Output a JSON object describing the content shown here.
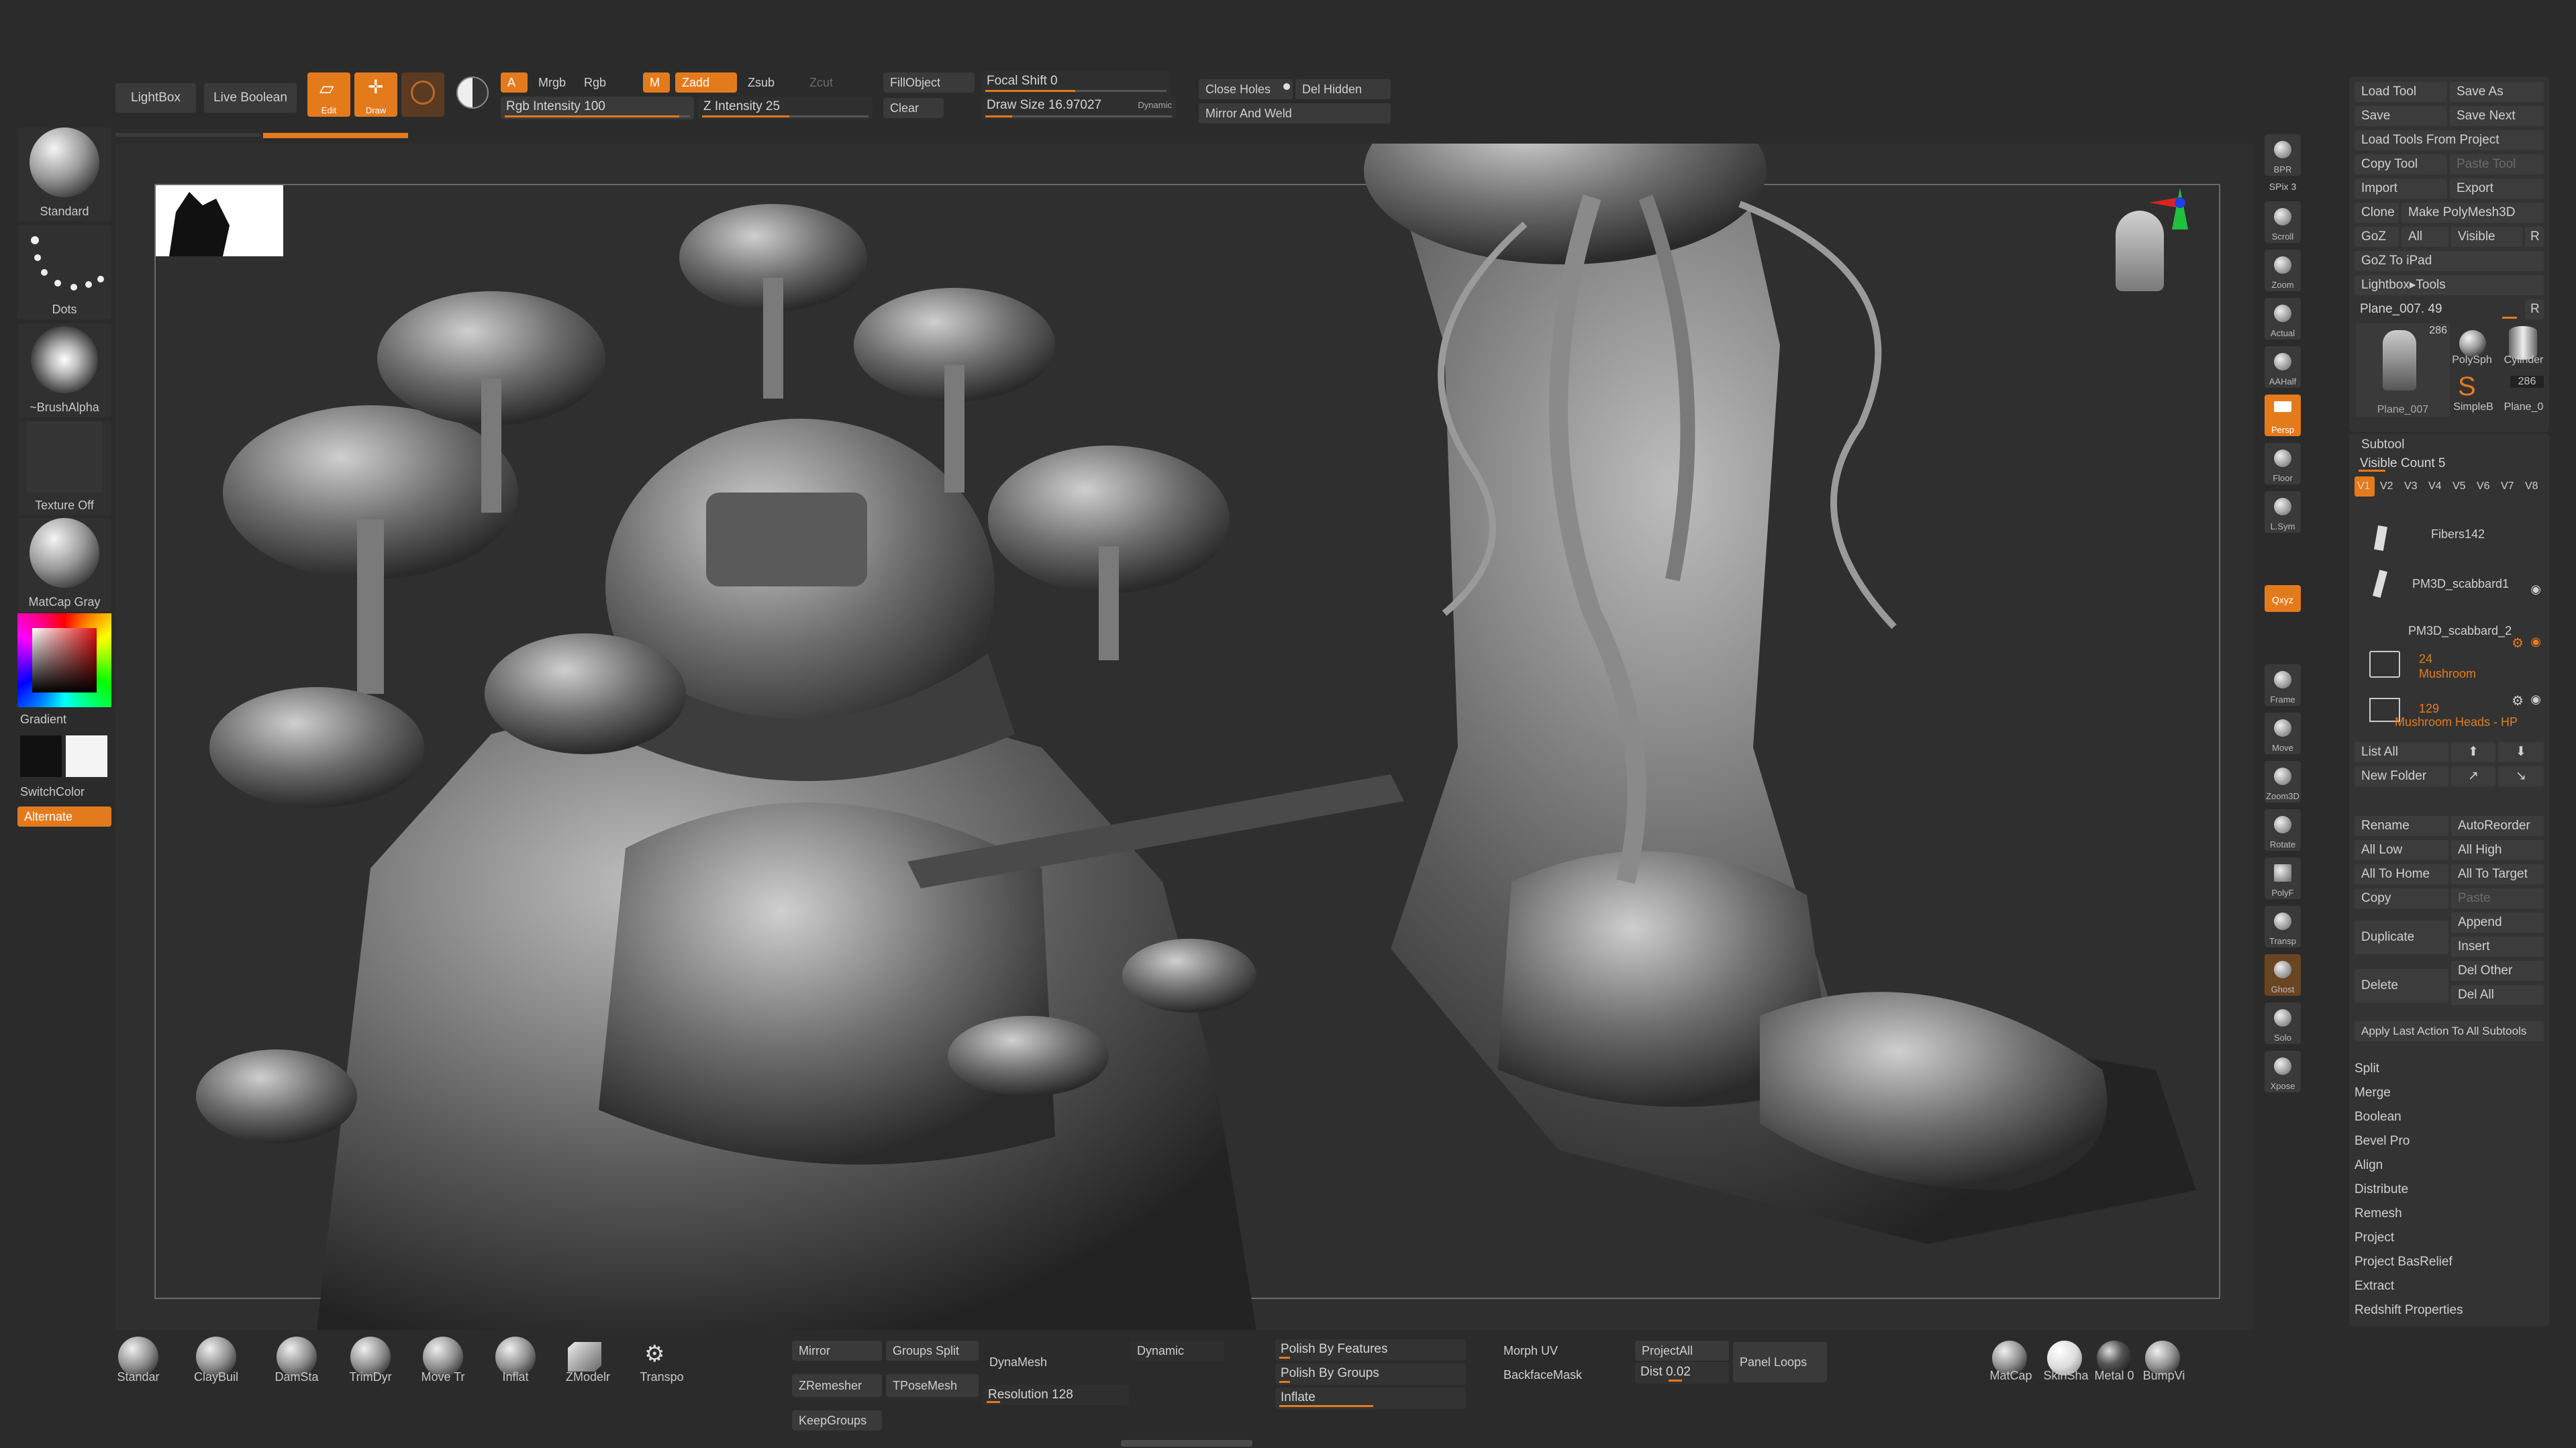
{
  "top": {
    "lightbox": "LightBox",
    "live_boolean": "Live Boolean",
    "edit": "Edit",
    "draw": "Draw",
    "a": "A",
    "mrgb": "Mrgb",
    "rgb": "Rgb",
    "m": "M",
    "zadd": "Zadd",
    "zsub": "Zsub",
    "zcut": "Zcut",
    "rgb_intensity": "Rgb Intensity 100",
    "z_intensity": "Z Intensity 25",
    "fill_object": "FillObject",
    "clear": "Clear",
    "focal_shift": "Focal Shift 0",
    "draw_size": "Draw Size 16.97027",
    "dynamic": "Dynamic",
    "close_holes": "Close Holes",
    "del_hidden": "Del Hidden",
    "mirror_weld": "Mirror And Weld"
  },
  "left": {
    "standard": "Standard",
    "dots": "Dots",
    "brush_alpha": "~BrushAlpha",
    "texture_off": "Texture Off",
    "matcap_gray": "MatCap Gray",
    "gradient": "Gradient",
    "switch_color": "SwitchColor",
    "alternate": "Alternate"
  },
  "right_icons": [
    "BPR",
    "SPix 3",
    "Scroll",
    "Zoom",
    "Actual",
    "AAHalf",
    "Persp",
    "Floor",
    "L.Sym",
    "Qxyz",
    "Frame",
    "Move",
    "Zoom3D",
    "Rotate",
    "PolyF",
    "Transp",
    "Ghost",
    "Solo",
    "Xpose"
  ],
  "tool": {
    "load_tool": "Load Tool",
    "save_as": "Save As",
    "save": "Save",
    "save_next": "Save Next",
    "load_from_project": "Load Tools From Project",
    "copy_tool": "Copy Tool",
    "paste_tool": "Paste Tool",
    "import": "Import",
    "export": "Export",
    "clone": "Clone",
    "make_polymesh": "Make PolyMesh3D",
    "goz": "GoZ",
    "all": "All",
    "visible": "Visible",
    "r": "R",
    "goz_ipad": "GoZ To iPad",
    "lightbox_tools": "Lightbox▸Tools",
    "plane_value": "Plane_007. 49",
    "r2": "R",
    "thumb_count": "286",
    "thumb_count2": "286",
    "plane_007": "Plane_007",
    "polysph": "PolySph",
    "cylinder": "Cylinder",
    "simpleb": "SimpleB",
    "plane_0": "Plane_0"
  },
  "subtool": {
    "title": "Subtool",
    "visible_count": "Visible Count 5",
    "versions": [
      "V1",
      "V2",
      "V3",
      "V4",
      "V5",
      "V6",
      "V7",
      "V8"
    ],
    "items": [
      {
        "name": "Fibers142"
      },
      {
        "name": "PM3D_scabbard1"
      },
      {
        "name": "PM3D_scabbard_2"
      },
      {
        "count": "24",
        "name": "Mushroom"
      },
      {
        "count": "129",
        "name": "Mushroom Heads - HP"
      }
    ],
    "list_all": "List All",
    "new_folder": "New Folder",
    "rename": "Rename",
    "autoreorder": "AutoReorder",
    "all_low": "All Low",
    "all_high": "All High",
    "all_to_home": "All To Home",
    "all_to_target": "All To Target",
    "copy": "Copy",
    "paste": "Paste",
    "duplicate": "Duplicate",
    "append": "Append",
    "insert": "Insert",
    "delete": "Delete",
    "del_other": "Del Other",
    "del_all": "Del All",
    "apply_last": "Apply Last Action To All Subtools",
    "menu": [
      "Split",
      "Merge",
      "Boolean",
      "Bevel Pro",
      "Align",
      "Distribute",
      "Remesh",
      "Project",
      "Project BasRelief",
      "Extract",
      "Redshift Properties"
    ]
  },
  "bottom": {
    "brushes": [
      "Standar",
      "ClayBuil",
      "DamSta",
      "TrimDyr",
      "Move Tr",
      "Inflat",
      "ZModelr",
      "Transpo"
    ],
    "mirror": "Mirror",
    "groups_split": "Groups Split",
    "dynamesh": "DynaMesh",
    "zremesher": "ZRemesher",
    "tposemesh": "TPoseMesh",
    "resolution": "Resolution 128",
    "keepgroups": "KeepGroups",
    "dynamic": "Dynamic",
    "polish_features": "Polish By Features",
    "polish_groups": "Polish By Groups",
    "inflate": "Inflate",
    "morph_uv": "Morph UV",
    "backfacemask": "BackfaceMask",
    "projectall": "ProjectAll",
    "dist": "Dist 0.02",
    "panel_loops": "Panel Loops",
    "materials": [
      "MatCap",
      "SkinSha",
      "Metal 0",
      "BumpVi"
    ]
  }
}
